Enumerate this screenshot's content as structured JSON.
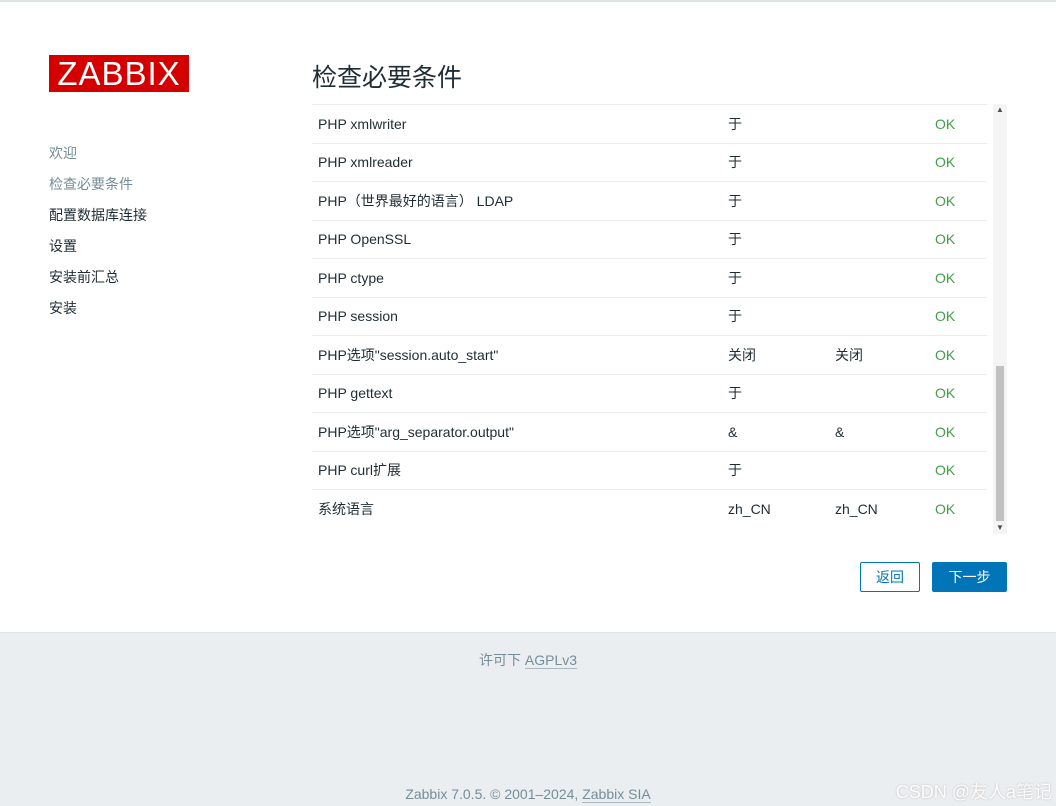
{
  "brand": {
    "logo_text": "ZABBIX",
    "logo_color": "#d40000"
  },
  "steps": [
    {
      "label": "欢迎",
      "state": "done"
    },
    {
      "label": "检查必要条件",
      "state": "current"
    },
    {
      "label": "配置数据库连接",
      "state": "pending"
    },
    {
      "label": "设置",
      "state": "pending"
    },
    {
      "label": "安装前汇总",
      "state": "pending"
    },
    {
      "label": "安装",
      "state": "pending"
    }
  ],
  "page_title": "检查必要条件",
  "requirements": [
    {
      "name": "PHP xmlwriter",
      "current": "于",
      "required": "",
      "status": "OK"
    },
    {
      "name": "PHP xmlreader",
      "current": "于",
      "required": "",
      "status": "OK"
    },
    {
      "name": "PHP（世界最好的语言） LDAP",
      "current": "于",
      "required": "",
      "status": "OK"
    },
    {
      "name": "PHP OpenSSL",
      "current": "于",
      "required": "",
      "status": "OK"
    },
    {
      "name": "PHP ctype",
      "current": "于",
      "required": "",
      "status": "OK"
    },
    {
      "name": "PHP session",
      "current": "于",
      "required": "",
      "status": "OK"
    },
    {
      "name": "PHP选项\"session.auto_start\"",
      "current": "关闭",
      "required": "关闭",
      "status": "OK"
    },
    {
      "name": "PHP gettext",
      "current": "于",
      "required": "",
      "status": "OK"
    },
    {
      "name": "PHP选项\"arg_separator.output\"",
      "current": "&",
      "required": "&",
      "status": "OK"
    },
    {
      "name": "PHP curl扩展",
      "current": "于",
      "required": "",
      "status": "OK"
    },
    {
      "name": "系统语言",
      "current": "zh_CN",
      "required": "zh_CN",
      "status": "OK"
    }
  ],
  "buttons": {
    "back": "返回",
    "next": "下一步"
  },
  "footer": {
    "license_prefix": "许可下",
    "license_link": "AGPLv3",
    "copyright_prefix": "Zabbix 7.0.5. © 2001–2024,",
    "copyright_link": "Zabbix SIA"
  },
  "watermark": "CSDN @友人a笔记",
  "colors": {
    "accent": "#0275b8",
    "ok": "#429e47",
    "muted": "#768d99"
  }
}
